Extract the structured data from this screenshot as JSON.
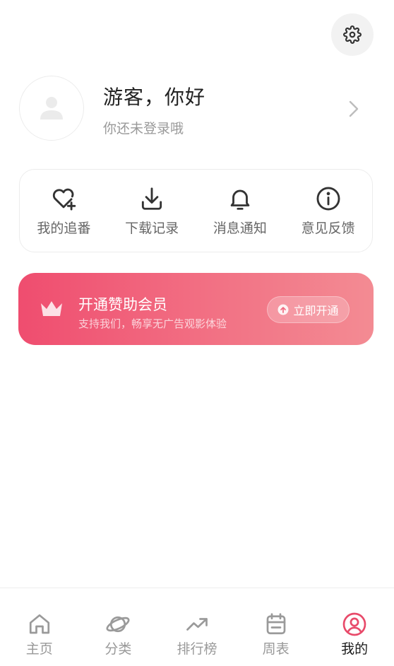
{
  "header": {
    "settings_icon": "gear-icon"
  },
  "profile": {
    "greeting": "游客，你好",
    "subtitle": "你还未登录哦",
    "avatar_icon": "user-icon",
    "chevron_icon": "chevron-right-icon"
  },
  "quick_actions": [
    {
      "label": "我的追番",
      "icon": "heart-plus-icon"
    },
    {
      "label": "下载记录",
      "icon": "download-icon"
    },
    {
      "label": "消息通知",
      "icon": "bell-icon"
    },
    {
      "label": "意见反馈",
      "icon": "info-icon"
    }
  ],
  "vip": {
    "title": "开通赞助会员",
    "subtitle": "支持我们，畅享无广告观影体验",
    "button_label": "立即开通",
    "icon": "crown-icon",
    "gradient_start": "#ef4d6f",
    "gradient_end": "#f38b93"
  },
  "bottom_nav": {
    "active_index": 4,
    "active_color": "#e84a6a",
    "items": [
      {
        "label": "主页",
        "icon": "home-icon"
      },
      {
        "label": "分类",
        "icon": "planet-icon"
      },
      {
        "label": "排行榜",
        "icon": "trending-icon"
      },
      {
        "label": "周表",
        "icon": "calendar-icon"
      },
      {
        "label": "我的",
        "icon": "profile-icon"
      }
    ]
  }
}
